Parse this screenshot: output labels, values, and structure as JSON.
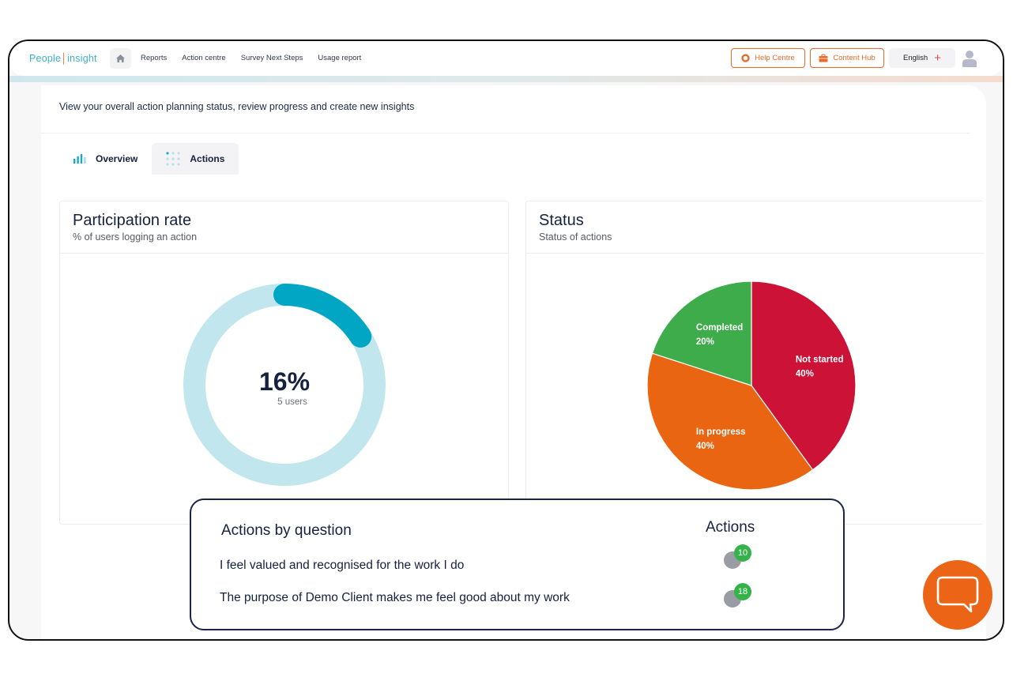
{
  "header": {
    "logo_text_a": "People",
    "logo_text_b": "insight",
    "nav": [
      "Reports",
      "Action centre",
      "Survey Next Steps",
      "Usage report"
    ],
    "help_label": "Help Centre",
    "hub_label": "Content Hub",
    "language": "English",
    "icons": {
      "home": "home-icon",
      "help": "lifebuoy-icon",
      "hub": "briefcase-icon",
      "language": "plus-icon",
      "user": "user-icon"
    }
  },
  "intro": "View your overall action planning status, review progress and create new insights",
  "tabs": [
    {
      "label": "Overview",
      "icon": "bar-chart-icon",
      "active": false
    },
    {
      "label": "Actions",
      "icon": "dots-grid-icon",
      "active": true
    }
  ],
  "participation": {
    "title": "Participation rate",
    "subtitle": "% of users  logging an action",
    "percent_label": "16%",
    "users_label": "5 users",
    "value_fraction": 0.16
  },
  "status": {
    "title": "Status",
    "subtitle": "Status of actions"
  },
  "chart_data": {
    "type": "pie",
    "title": "Status",
    "slices": [
      {
        "label": "Not started",
        "value": 40,
        "value_label": "40%",
        "color": "#cc1237"
      },
      {
        "label": "In progress",
        "value": 40,
        "value_label": "40%",
        "color": "#ea6511"
      },
      {
        "label": "Completed",
        "value": 20,
        "value_label": "20%",
        "color": "#3fac4b"
      }
    ]
  },
  "actions_by_question": {
    "title": "Actions by question",
    "column_header": "Actions",
    "rows": [
      {
        "question": "I feel valued and recognised for the work I do",
        "count": "10"
      },
      {
        "question": "The purpose of Demo Client makes me feel good about my work",
        "count": "18"
      }
    ]
  },
  "colors": {
    "accent_orange": "#e8692a",
    "teal": "#00a6c4",
    "teal_light": "#c2e6ee",
    "navy": "#16213e",
    "badge_green": "#35b34a"
  },
  "chat_icon": "chat-bubble-icon"
}
